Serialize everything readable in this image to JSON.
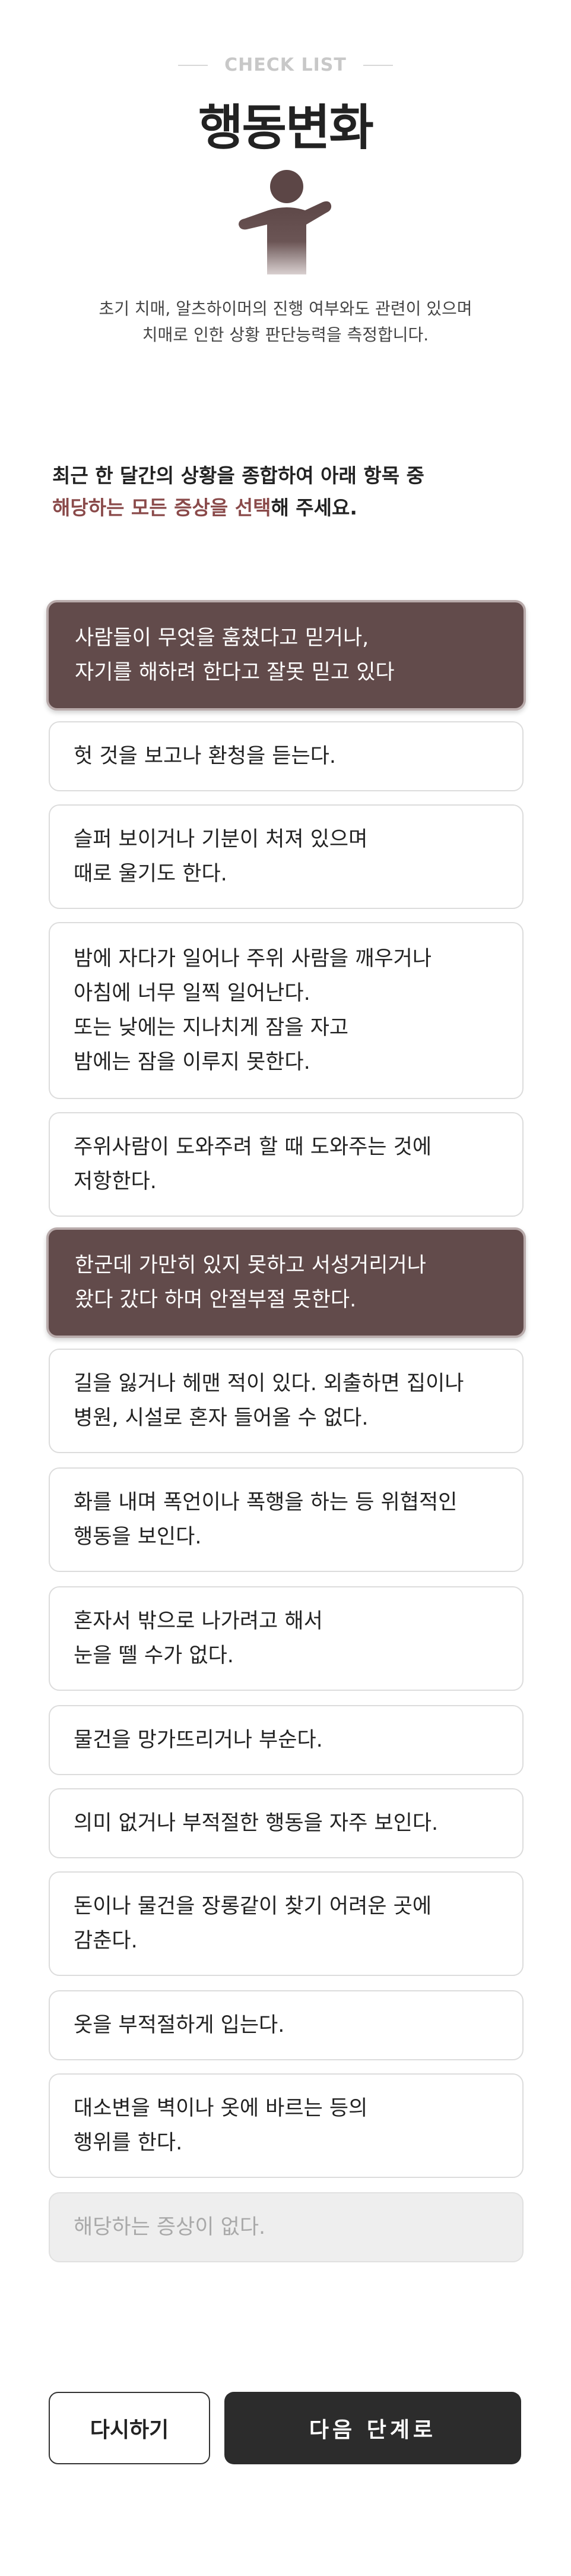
{
  "header": {
    "eyebrow": "CHECK LIST",
    "title": "행동변화",
    "description_line1": "초기 치매, 알츠하이머의 진행 여부와도 관련이 있으며",
    "description_line2": "치매로 인한 상황 판단능력을 측정합니다."
  },
  "instruction": {
    "line1": "최근 한 달간의 상황을 종합하여 아래 항목 중",
    "line2_highlight": "해당하는 모든 증상을 선택",
    "line2_rest": "해 주세요."
  },
  "options": [
    {
      "label": "사람들이 무엇을 훔쳤다고 믿거나,\n자기를 해하려 한다고 잘못 믿고 있다",
      "selected": true
    },
    {
      "label": "헛 것을 보고나 환청을 듣는다.",
      "selected": false
    },
    {
      "label": "슬퍼 보이거나 기분이 처져 있으며\n때로 울기도 한다.",
      "selected": false
    },
    {
      "label": "밤에 자다가 일어나 주위 사람을 깨우거나\n아침에 너무 일찍 일어난다.\n또는 낮에는 지나치게 잠을 자고\n밤에는 잠을 이루지 못한다.",
      "selected": false
    },
    {
      "label": "주위사람이 도와주려 할 때 도와주는 것에\n저항한다.",
      "selected": false
    },
    {
      "label": "한군데 가만히 있지 못하고 서성거리거나\n왔다 갔다 하며 안절부절 못한다.",
      "selected": true
    },
    {
      "label": "길을 잃거나 헤맨 적이 있다. 외출하면 집이나\n병원, 시설로 혼자 들어올 수 없다.",
      "selected": false
    },
    {
      "label": "화를 내며 폭언이나 폭행을 하는 등 위협적인\n행동을 보인다.",
      "selected": false
    },
    {
      "label": "혼자서 밖으로 나가려고 해서\n눈을 뗄 수가 없다.",
      "selected": false
    },
    {
      "label": "물건을 망가뜨리거나 부순다.",
      "selected": false
    },
    {
      "label": "의미 없거나 부적절한 행동을 자주 보인다.",
      "selected": false
    },
    {
      "label": "돈이나 물건을 장롱같이 찾기 어려운 곳에\n감춘다.",
      "selected": false
    },
    {
      "label": "옷을 부적절하게 입는다.",
      "selected": false
    },
    {
      "label": "대소변을 벽이나 옷에 바르는 등의\n행위를 한다.",
      "selected": false
    },
    {
      "label": "해당하는 증상이 없다.",
      "selected": false
    }
  ],
  "buttons": {
    "reset": "다시하기",
    "next": "다음 단계로"
  },
  "colors": {
    "accent": "#624b4b",
    "highlight_text": "#8a4a4a",
    "primary_button": "#2c2c2c"
  },
  "icons": {
    "figure": "person-shrug-icon"
  }
}
